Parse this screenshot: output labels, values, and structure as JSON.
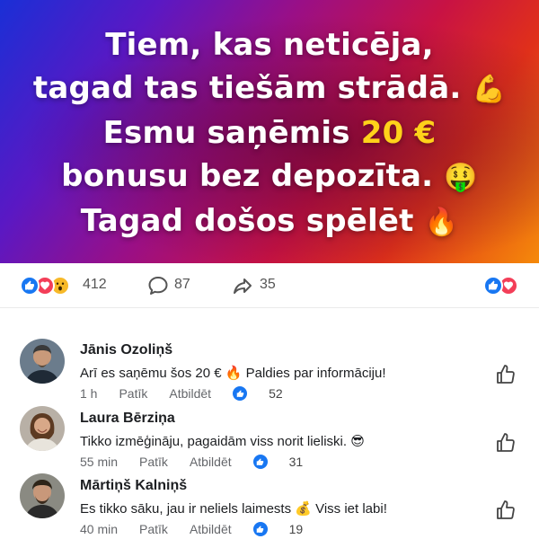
{
  "hero": {
    "line1": "Tiem, kas neticēja,",
    "line2": "tagad tas tiešām strādā.",
    "line2_emoji": "💪",
    "line3_prefix": "Esmu saņēmis ",
    "line3_amount": "20 €",
    "line4": "bonusu bez depozīta.",
    "line4_emoji": "🤑",
    "line5": "Tagad došos spēlēt",
    "line5_emoji": "🔥",
    "colors": {
      "amount": "#ffd21a",
      "text": "#ffffff"
    }
  },
  "stats": {
    "reactions_count": "412",
    "comments_count": "87",
    "shares_count": "35",
    "reaction_icons": [
      "like-icon",
      "love-icon",
      "wow-icon"
    ]
  },
  "comments": [
    {
      "name": "Jānis Ozoliņš",
      "text": "Arī es saņēmu šos 20 € 🔥 Paldies par informāciju!",
      "time": "1 h",
      "like_label": "Patīk",
      "reply_label": "Atbildēt",
      "likes": "52"
    },
    {
      "name": "Laura Bērziņa",
      "text": "Tikko izmēģināju, pagaidām viss norit lieliski. 😎",
      "time": "55 min",
      "like_label": "Patīk",
      "reply_label": "Atbildēt",
      "likes": "31"
    },
    {
      "name": "Mārtiņš Kalniņš",
      "text": "Es tikko sāku, jau ir neliels laimests 💰  Viss iet labi!",
      "time": "40 min",
      "like_label": "Patīk",
      "reply_label": "Atbildēt",
      "likes": "19"
    }
  ],
  "colors": {
    "like_blue": "#1877f2",
    "love_red": "#f33e58",
    "wow_yellow": "#f7b928"
  }
}
